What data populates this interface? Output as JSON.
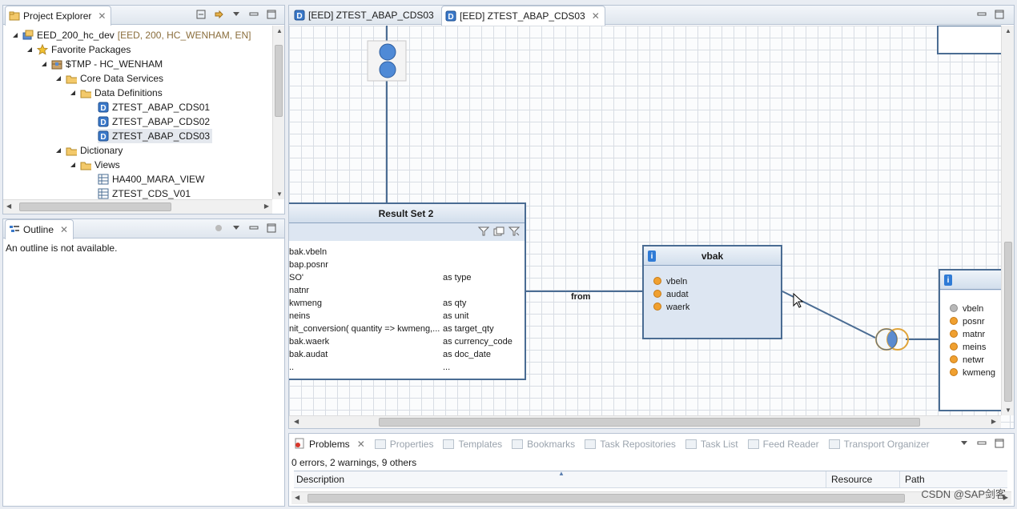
{
  "project_explorer": {
    "title": "Project Explorer",
    "tree": [
      {
        "label": "EED_200_hc_dev",
        "meta": "[EED, 200, HC_WENHAM, EN]",
        "icon": "abap-project-icon",
        "depth": 0,
        "expanded": true
      },
      {
        "label": "Favorite Packages",
        "icon": "star-icon",
        "depth": 1,
        "expanded": true
      },
      {
        "label": "$TMP - HC_WENHAM",
        "icon": "package-icon",
        "depth": 2,
        "expanded": true
      },
      {
        "label": "Core Data Services",
        "icon": "folder-icon",
        "depth": 3,
        "expanded": true
      },
      {
        "label": "Data Definitions",
        "icon": "folder-icon",
        "depth": 4,
        "expanded": true
      },
      {
        "label": "ZTEST_ABAP_CDS01",
        "icon": "ddl-icon",
        "depth": 5
      },
      {
        "label": "ZTEST_ABAP_CDS02",
        "icon": "ddl-icon",
        "depth": 5
      },
      {
        "label": "ZTEST_ABAP_CDS03",
        "icon": "ddl-icon",
        "depth": 5,
        "selected": true
      },
      {
        "label": "Dictionary",
        "icon": "folder-icon",
        "depth": 3,
        "expanded": true
      },
      {
        "label": "Views",
        "icon": "folder-icon",
        "depth": 4,
        "expanded": true
      },
      {
        "label": "HA400_MARA_VIEW",
        "icon": "view-icon",
        "depth": 5
      },
      {
        "label": "ZTEST_CDS_V01",
        "icon": "view-icon",
        "depth": 5
      }
    ]
  },
  "outline": {
    "title": "Outline",
    "message": "An outline is not available."
  },
  "editor": {
    "tabs": [
      {
        "label": "[EED] ZTEST_ABAP_CDS03",
        "active": false
      },
      {
        "label": "[EED] ZTEST_ABAP_CDS03",
        "active": true
      }
    ]
  },
  "diagram": {
    "result_set": {
      "title": "Result Set 2",
      "rows": [
        {
          "expr": "bak.vbeln",
          "alias": ""
        },
        {
          "expr": "bap.posnr",
          "alias": ""
        },
        {
          "expr": "SO'",
          "alias": "as type"
        },
        {
          "expr": "natnr",
          "alias": ""
        },
        {
          "expr": "kwmeng",
          "alias": "as qty"
        },
        {
          "expr": "neins",
          "alias": "as unit"
        },
        {
          "expr": "nit_conversion( quantity => kwmeng,...",
          "alias": "as target_qty"
        },
        {
          "expr": "bak.waerk",
          "alias": "as currency_code"
        },
        {
          "expr": "bak.audat",
          "alias": "as doc_date"
        },
        {
          "expr": "..",
          "alias": "..."
        }
      ]
    },
    "from_label": "from",
    "vbak": {
      "title": "vbak",
      "fields": [
        "vbeln",
        "audat",
        "waerk"
      ]
    },
    "right_table": {
      "fields": [
        {
          "name": "vbeln",
          "key": true
        },
        {
          "name": "posnr",
          "key": false
        },
        {
          "name": "matnr",
          "key": false
        },
        {
          "name": "meins",
          "key": false
        },
        {
          "name": "netwr",
          "key": false
        },
        {
          "name": "kwmeng",
          "key": false
        }
      ]
    }
  },
  "problems": {
    "tabs": [
      "Problems",
      "Properties",
      "Templates",
      "Bookmarks",
      "Task Repositories",
      "Task List",
      "Feed Reader",
      "Transport Organizer"
    ],
    "summary": "0 errors, 2 warnings, 9 others",
    "columns": [
      "Description",
      "Resource",
      "Path"
    ]
  },
  "watermark": "CSDN @SAP剑客"
}
